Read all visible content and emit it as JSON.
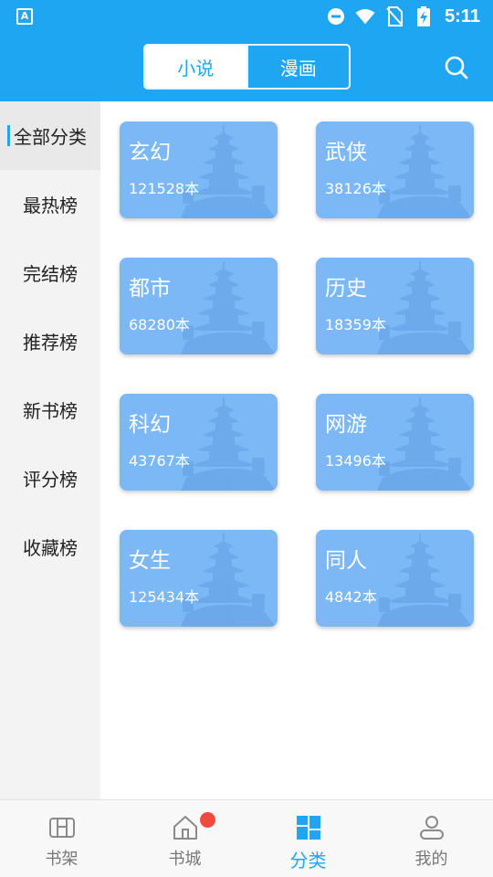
{
  "status_bar": {
    "app_icon_glyph": "A",
    "time": "5:11",
    "icons": [
      "do-not-disturb-icon",
      "wifi-icon",
      "no-sim-icon",
      "battery-charging-icon"
    ]
  },
  "top_bar": {
    "tabs": [
      {
        "label": "小说",
        "active": true
      },
      {
        "label": "漫画",
        "active": false
      }
    ],
    "search_icon": "search-icon",
    "accent_color": "#1ea6f2"
  },
  "sidebar": {
    "items": [
      {
        "label": "全部分类",
        "active": true
      },
      {
        "label": "最热榜",
        "active": false
      },
      {
        "label": "完结榜",
        "active": false
      },
      {
        "label": "推荐榜",
        "active": false
      },
      {
        "label": "新书榜",
        "active": false
      },
      {
        "label": "评分榜",
        "active": false
      },
      {
        "label": "收藏榜",
        "active": false
      }
    ]
  },
  "categories": [
    {
      "name": "玄幻",
      "count": "121528本"
    },
    {
      "name": "武侠",
      "count": "38126本"
    },
    {
      "name": "都市",
      "count": "68280本"
    },
    {
      "name": "历史",
      "count": "18359本"
    },
    {
      "name": "科幻",
      "count": "43767本"
    },
    {
      "name": "网游",
      "count": "13496本"
    },
    {
      "name": "女生",
      "count": "125434本"
    },
    {
      "name": "同人",
      "count": "4842本"
    }
  ],
  "category_card_color": "#7cb8f5",
  "bottom_nav": {
    "items": [
      {
        "label": "书架",
        "icon": "bookshelf-icon",
        "active": false,
        "badge": false
      },
      {
        "label": "书城",
        "icon": "home-icon",
        "active": false,
        "badge": true
      },
      {
        "label": "分类",
        "icon": "category-grid-icon",
        "active": true,
        "badge": false
      },
      {
        "label": "我的",
        "icon": "profile-icon",
        "active": false,
        "badge": false
      }
    ],
    "badge_color": "#f04a3f"
  }
}
